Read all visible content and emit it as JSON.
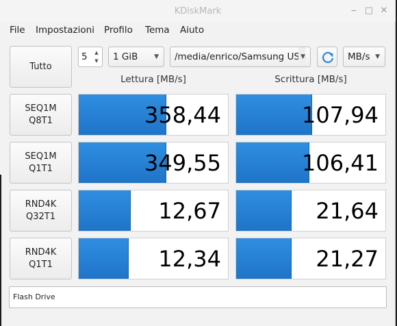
{
  "window": {
    "title": "KDiskMark",
    "controls": [
      "minimize",
      "maximize",
      "close"
    ]
  },
  "menu": [
    "File",
    "Impostazioni",
    "Profilo",
    "Tema",
    "Aiuto"
  ],
  "toolbar": {
    "all_label": "Tutto",
    "loops": "5",
    "size": "1 GiB",
    "path": "/media/enrico/Samsung USB",
    "unit": "MB/s"
  },
  "headers": {
    "read": "Lettura [MB/s]",
    "write": "Scrittura [MB/s]"
  },
  "tests": [
    {
      "label_line1": "SEQ1M",
      "label_line2": "Q8T1",
      "read": "358,44",
      "write": "107,94",
      "read_fill": 0.589,
      "write_fill": 0.509
    },
    {
      "label_line1": "SEQ1M",
      "label_line2": "Q1T1",
      "read": "349,55",
      "write": "106,41",
      "read_fill": 0.589,
      "write_fill": 0.491
    },
    {
      "label_line1": "RND4K",
      "label_line2": "Q32T1",
      "read": "12,67",
      "write": "21,64",
      "read_fill": 0.349,
      "write_fill": 0.373
    },
    {
      "label_line1": "RND4K",
      "label_line2": "Q1T1",
      "read": "12,34",
      "write": "21,27",
      "read_fill": 0.335,
      "write_fill": 0.373
    }
  ],
  "comment": "Flash Drive"
}
